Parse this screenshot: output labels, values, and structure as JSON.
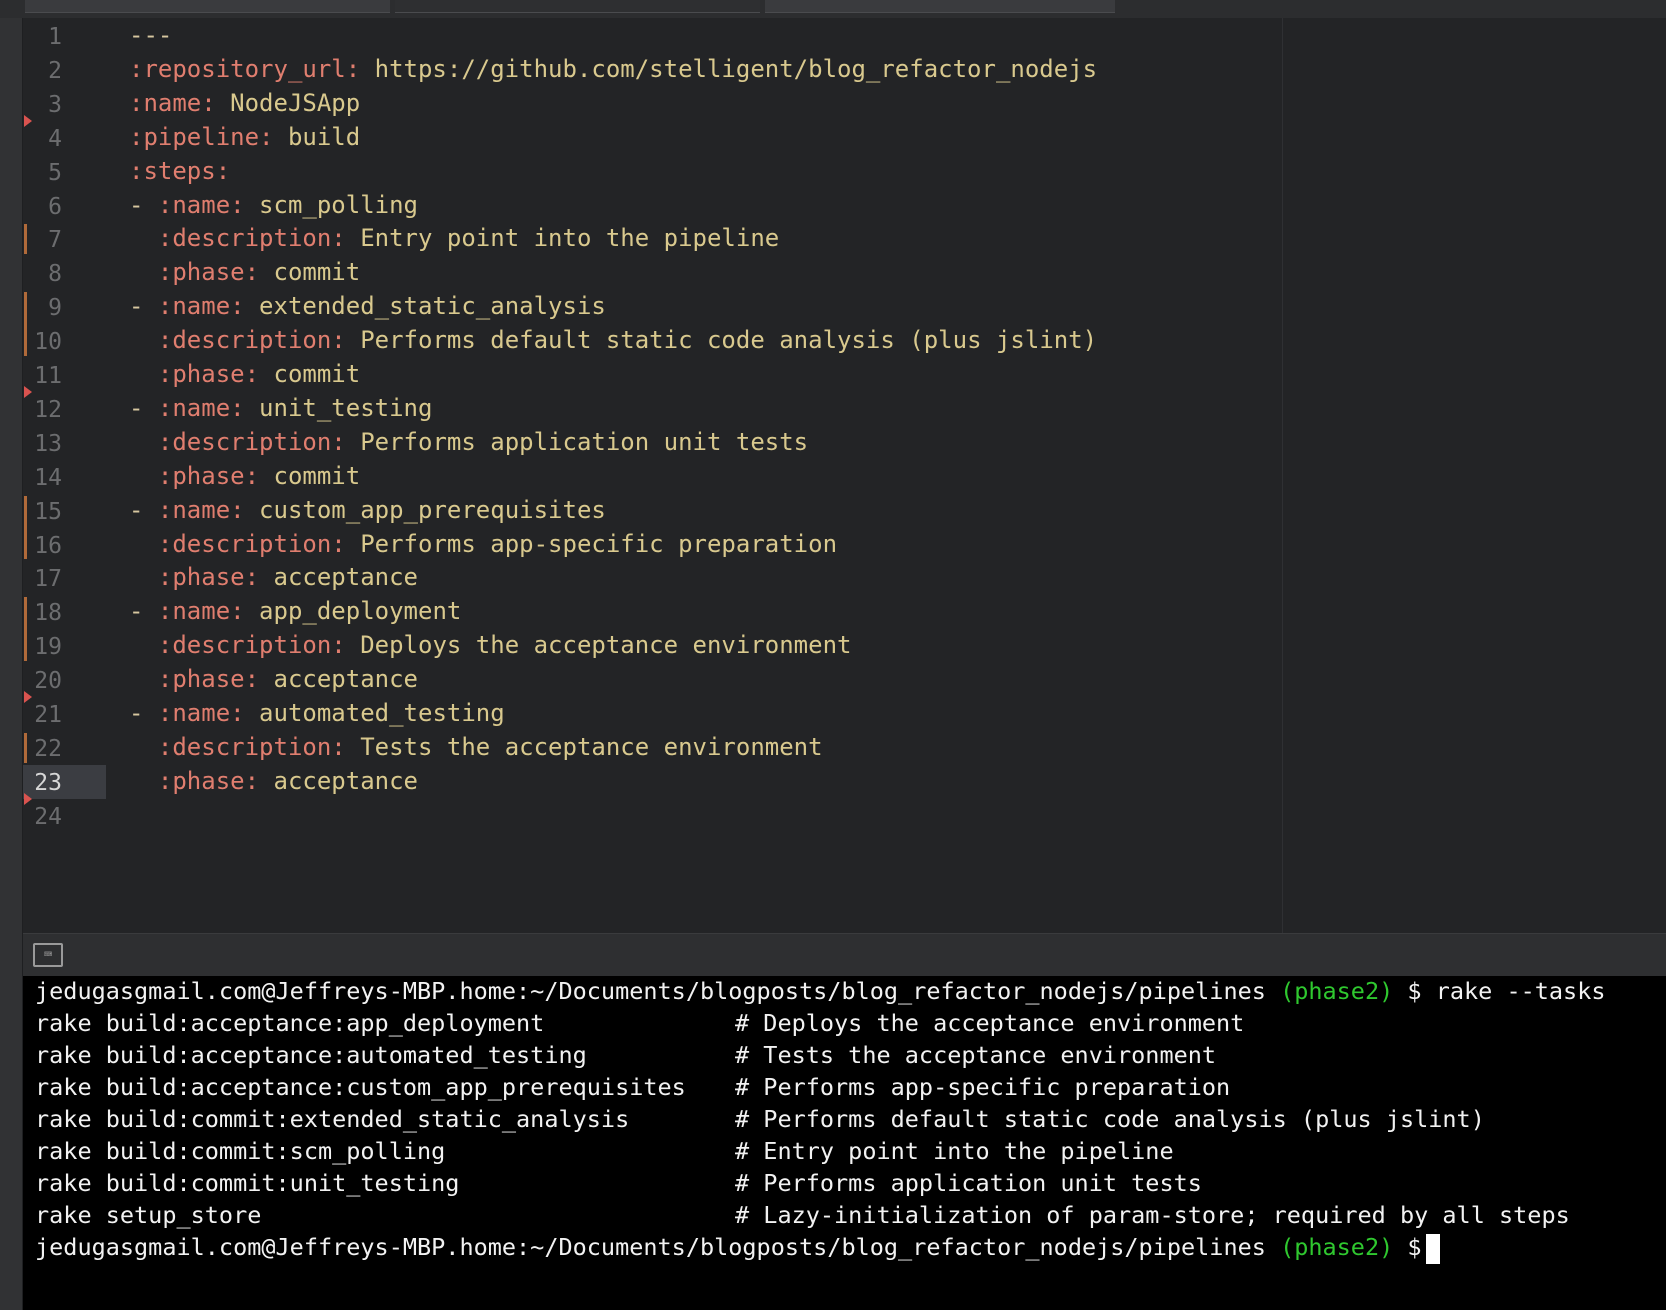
{
  "editor": {
    "line_numbers": [
      "1",
      "2",
      "3",
      "4",
      "5",
      "6",
      "7",
      "8",
      "9",
      "10",
      "11",
      "12",
      "13",
      "14",
      "15",
      "16",
      "17",
      "18",
      "19",
      "20",
      "21",
      "22",
      "23",
      "24"
    ],
    "active_line": "23",
    "lines": [
      {
        "parts": [
          [
            "d",
            "---"
          ]
        ]
      },
      {
        "parts": [
          [
            "k",
            ":repository_url:"
          ],
          [
            "v",
            " https://github.com/stelligent/blog_refactor_nodejs"
          ]
        ]
      },
      {
        "parts": [
          [
            "k",
            ":name:"
          ],
          [
            "v",
            " NodeJSApp"
          ]
        ]
      },
      {
        "parts": [
          [
            "k",
            ":pipeline:"
          ],
          [
            "v",
            " build"
          ]
        ]
      },
      {
        "parts": [
          [
            "k",
            ":steps:"
          ]
        ]
      },
      {
        "parts": [
          [
            "d",
            "- "
          ],
          [
            "k",
            ":name:"
          ],
          [
            "v",
            " scm_polling"
          ]
        ]
      },
      {
        "parts": [
          [
            "d",
            "  "
          ],
          [
            "k",
            ":description:"
          ],
          [
            "v",
            " Entry point into the pipeline"
          ]
        ]
      },
      {
        "parts": [
          [
            "d",
            "  "
          ],
          [
            "k",
            ":phase:"
          ],
          [
            "v",
            " commit"
          ]
        ]
      },
      {
        "parts": [
          [
            "d",
            "- "
          ],
          [
            "k",
            ":name:"
          ],
          [
            "v",
            " extended_static_analysis"
          ]
        ]
      },
      {
        "parts": [
          [
            "d",
            "  "
          ],
          [
            "k",
            ":description:"
          ],
          [
            "v",
            " Performs default static code analysis (plus jslint)"
          ]
        ]
      },
      {
        "parts": [
          [
            "d",
            "  "
          ],
          [
            "k",
            ":phase:"
          ],
          [
            "v",
            " commit"
          ]
        ]
      },
      {
        "parts": [
          [
            "d",
            "- "
          ],
          [
            "k",
            ":name:"
          ],
          [
            "v",
            " unit_testing"
          ]
        ]
      },
      {
        "parts": [
          [
            "d",
            "  "
          ],
          [
            "k",
            ":description:"
          ],
          [
            "v",
            " Performs application unit tests"
          ]
        ]
      },
      {
        "parts": [
          [
            "d",
            "  "
          ],
          [
            "k",
            ":phase:"
          ],
          [
            "v",
            " commit"
          ]
        ]
      },
      {
        "parts": [
          [
            "d",
            "- "
          ],
          [
            "k",
            ":name:"
          ],
          [
            "v",
            " custom_app_prerequisites"
          ]
        ]
      },
      {
        "parts": [
          [
            "d",
            "  "
          ],
          [
            "k",
            ":description:"
          ],
          [
            "v",
            " Performs app-specific preparation"
          ]
        ]
      },
      {
        "parts": [
          [
            "d",
            "  "
          ],
          [
            "k",
            ":phase:"
          ],
          [
            "v",
            " acceptance"
          ]
        ]
      },
      {
        "parts": [
          [
            "d",
            "- "
          ],
          [
            "k",
            ":name:"
          ],
          [
            "v",
            " app_deployment"
          ]
        ]
      },
      {
        "parts": [
          [
            "d",
            "  "
          ],
          [
            "k",
            ":description:"
          ],
          [
            "v",
            " Deploys the acceptance environment"
          ]
        ]
      },
      {
        "parts": [
          [
            "d",
            "  "
          ],
          [
            "k",
            ":phase:"
          ],
          [
            "v",
            " acceptance"
          ]
        ]
      },
      {
        "parts": [
          [
            "d",
            "- "
          ],
          [
            "k",
            ":name:"
          ],
          [
            "v",
            " automated_testing"
          ]
        ]
      },
      {
        "parts": [
          [
            "d",
            "  "
          ],
          [
            "k",
            ":description:"
          ],
          [
            "v",
            " Tests the acceptance environment"
          ]
        ]
      },
      {
        "parts": [
          [
            "d",
            "  "
          ],
          [
            "k",
            ":phase:"
          ],
          [
            "v",
            " acceptance"
          ]
        ]
      },
      {
        "parts": []
      }
    ],
    "colors": {
      "key": "#e07e6f",
      "value": "#d9c98e",
      "text": "#d7c7a0",
      "gutter_modified": "#b06a3a",
      "gutter_deleted": "#d9534f"
    }
  },
  "panel": {
    "keyboard_icon": "keyboard-icon",
    "keyboard_glyph": "⌨"
  },
  "terminal": {
    "prompt_path": "jedugasgmail.com@Jeffreys-MBP.home:~/Documents/blogposts/blog_refactor_nodejs/pipelines",
    "branch": "(phase2)",
    "prompt_symbol": "$",
    "command": "rake --tasks",
    "tasks": [
      {
        "task": "rake build:acceptance:app_deployment",
        "comment": "# Deploys the acceptance environment"
      },
      {
        "task": "rake build:acceptance:automated_testing",
        "comment": "# Tests the acceptance environment"
      },
      {
        "task": "rake build:acceptance:custom_app_prerequisites",
        "comment": "# Performs app-specific preparation"
      },
      {
        "task": "rake build:commit:extended_static_analysis",
        "comment": "# Performs default static code analysis (plus jslint)"
      },
      {
        "task": "rake build:commit:scm_polling",
        "comment": "# Entry point into the pipeline"
      },
      {
        "task": "rake build:commit:unit_testing",
        "comment": "# Performs application unit tests"
      },
      {
        "task": "rake setup_store",
        "comment": "# Lazy-initialization of param-store; required by all steps"
      }
    ],
    "colors": {
      "branch": "#2fc82f",
      "text": "#f2f2f2",
      "background": "#000000"
    }
  }
}
